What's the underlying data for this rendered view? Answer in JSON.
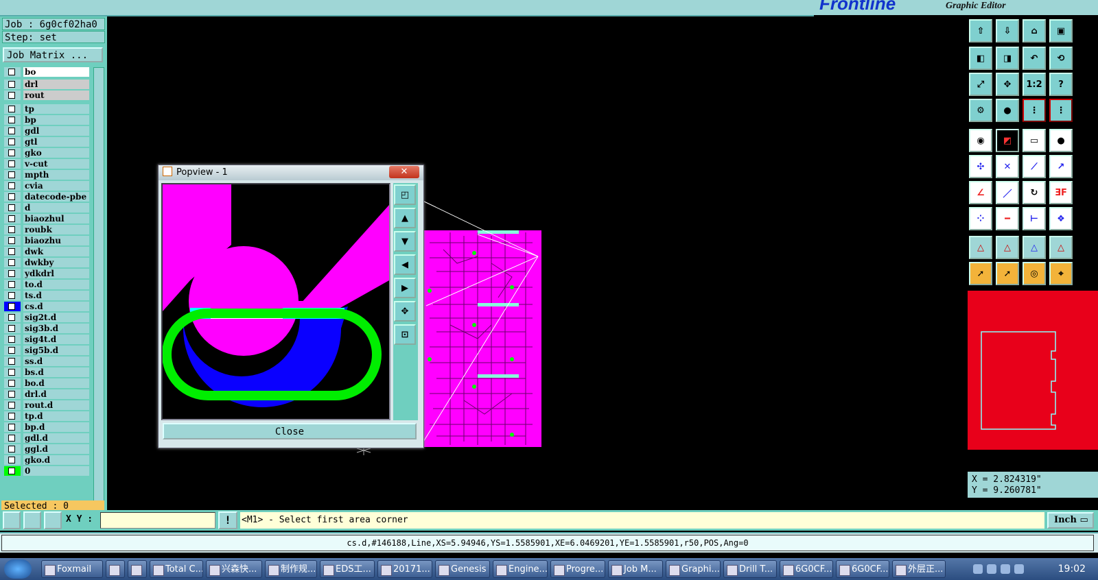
{
  "app": {
    "brand": "Frontline",
    "brand_subtitle": "Graphic Editor"
  },
  "left_panel": {
    "job": "Job : 6g0cf02ha0",
    "step": "Step: set",
    "job_matrix": "Job Matrix ...",
    "layers": [
      {
        "name": "bo"
      },
      {
        "name": "drl"
      },
      {
        "name": "rout"
      },
      {
        "name": "tp"
      },
      {
        "name": "bp"
      },
      {
        "name": "gdl"
      },
      {
        "name": "gtl"
      },
      {
        "name": "gko"
      },
      {
        "name": "v-cut"
      },
      {
        "name": "mpth"
      },
      {
        "name": "cvia"
      },
      {
        "name": "datecode-pbe"
      },
      {
        "name": "d"
      },
      {
        "name": "biaozhul"
      },
      {
        "name": "roubk"
      },
      {
        "name": "biaozhu"
      },
      {
        "name": "dwk"
      },
      {
        "name": "dwkby"
      },
      {
        "name": "ydkdrl"
      },
      {
        "name": "to.d"
      },
      {
        "name": "ts.d"
      },
      {
        "name": "cs.d"
      },
      {
        "name": "sig2t.d"
      },
      {
        "name": "sig3b.d"
      },
      {
        "name": "sig4t.d"
      },
      {
        "name": "sig5b.d"
      },
      {
        "name": "ss.d"
      },
      {
        "name": "bs.d"
      },
      {
        "name": "bo.d"
      },
      {
        "name": "drl.d"
      },
      {
        "name": "rout.d"
      },
      {
        "name": "tp.d"
      },
      {
        "name": "bp.d"
      },
      {
        "name": "gdl.d"
      },
      {
        "name": "ggl.d"
      },
      {
        "name": "gko.d"
      },
      {
        "name": "0"
      }
    ],
    "selected": "Selected : 0"
  },
  "popview": {
    "title": "Popview - 1",
    "close_label": "Close"
  },
  "coords": {
    "x": "X = 2.824319\"",
    "y": "Y = 9.260781\""
  },
  "command": {
    "xy_label": "X Y :",
    "prompt": "<M1> - Select first area corner",
    "units": "Inch"
  },
  "status_line": "cs.d,#146188,Line,XS=5.94946,YS=1.5585901,XE=6.0469201,YE=1.5585901,r50,POS,Ang=0",
  "taskbar": {
    "items": [
      "Foxmail",
      "",
      "",
      "Total C...",
      "兴森快...",
      "制作规...",
      "EDS工...",
      "20171...",
      "Genesis",
      "Engine...",
      "Progre...",
      "Job M...",
      "Graphi...",
      "Drill T...",
      "6G0CF...",
      "6G0CF...",
      "外层正..."
    ],
    "clock": "19:02"
  },
  "colors": {
    "panel": "#6fcfbf",
    "button": "#9fd6d6",
    "magenta": "#ff00ff",
    "green": "#00ff00",
    "blue": "#0000ff",
    "cyan": "#00ffff",
    "map_red": "#e8001a",
    "selected_bg": "#f6c760"
  }
}
